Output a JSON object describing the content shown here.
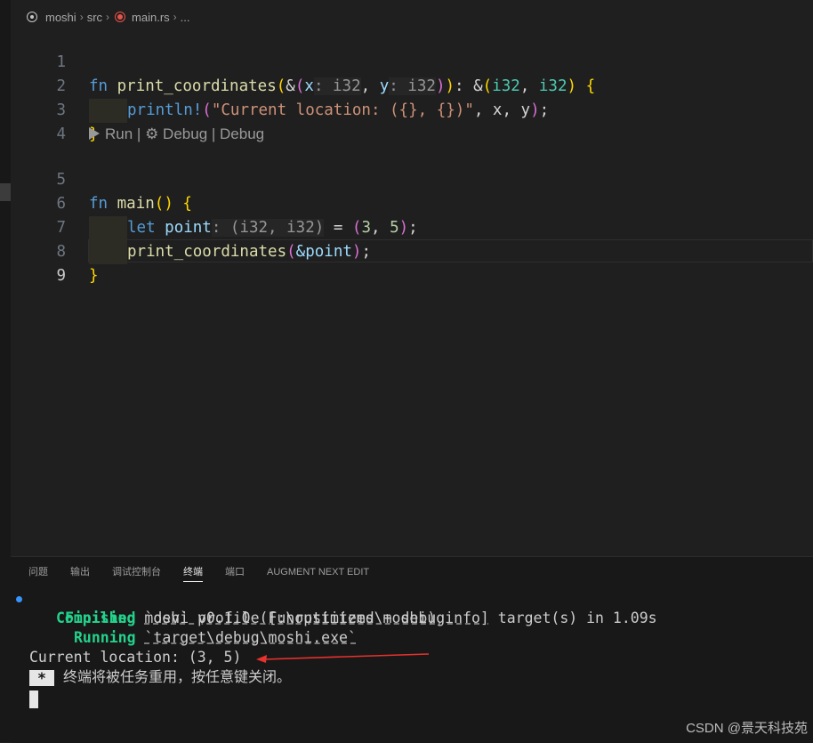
{
  "breadcrumb": {
    "project": "moshi",
    "folder": "src",
    "file": "main.rs",
    "more": "..."
  },
  "editor": {
    "line_numbers": [
      "1",
      "2",
      "3",
      "4",
      "5",
      "6",
      "7",
      "8",
      "9"
    ],
    "tokens": {
      "fn": "fn",
      "print_coordinates": "print_coordinates",
      "open_amp_paren": "(&(",
      "x": "x",
      "hint_colon_i32": ": i32",
      "comma": ", ",
      "y": "y",
      "close_ret": "): &(",
      "i32": "i32",
      "close_paren2": "))",
      "open_brace": " {",
      "println": "println!",
      "string_literal": "\"Current location: ({}, {})\"",
      "args": ", x, y",
      "close_paren_semi": ");",
      "close_brace": "}",
      "main": "main",
      "empty_parens": "()",
      "let": "let",
      "point": "point",
      "hint_type": ": (i32, i32)",
      "equals": " = ",
      "three": "3",
      "five": "5",
      "call_open": "(",
      "amp_point": "&point",
      "semi_close": ");"
    },
    "codelens": {
      "run": "Run",
      "sep": " | ",
      "debug1": "Debug",
      "debug2": "Debug"
    }
  },
  "panel": {
    "tabs": [
      "问题",
      "输出",
      "调试控制台",
      "终端",
      "端口",
      "AUGMENT NEXT EDIT"
    ],
    "active_tab": "终端",
    "terminal": {
      "compiling_label": "Compiling",
      "compiling_text": " moshi v0.1.0 (F:\\rustitems\\moshi)",
      "finished_label": "Finished",
      "finished_text_1": "`dev` profile [unoptimized + debuginfo]",
      "finished_text_2": " target(s) in 1.09s",
      "running_label": "Running",
      "running_text": "`target\\debug\\moshi.exe`",
      "output": "Current location: (3, 5)",
      "cursor_symbol": "*",
      "reuse_message": "终端将被任务重用，按任意键关闭。"
    }
  },
  "watermark": "CSDN @景天科技苑"
}
